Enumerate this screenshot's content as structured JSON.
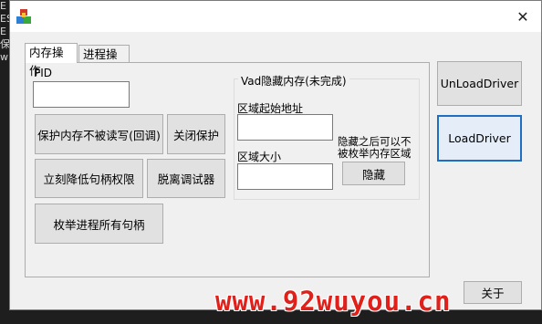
{
  "background_lines": [
    "E",
    "ES",
    "E",
    "保",
    "wi"
  ],
  "window": {
    "close_glyph": "✕"
  },
  "tabs": [
    {
      "label": "内存操作",
      "active": true
    },
    {
      "label": "进程操作",
      "active": false
    }
  ],
  "memory_tab": {
    "pid_label": "PID",
    "pid_value": "",
    "buttons": {
      "protect_memory": "保护内存不被读写(回调)",
      "close_protect": "关闭保护",
      "lower_handle": "立刻降低句柄权限",
      "detach_debugger": "脱离调试器",
      "enum_handles": "枚举进程所有句柄"
    },
    "vad_group": {
      "title": "Vad隐藏内存(未完成)",
      "start_addr_label": "区域起始地址",
      "start_addr_value": "",
      "size_label": "区域大小",
      "size_value": "",
      "note": "隐藏之后可以不被枚举内存区域",
      "hide_button": "隐藏"
    }
  },
  "side_buttons": {
    "unload": "UnLoadDriver",
    "load": "LoadDriver",
    "about": "关于"
  },
  "watermark": "www.92wuyou.cn"
}
